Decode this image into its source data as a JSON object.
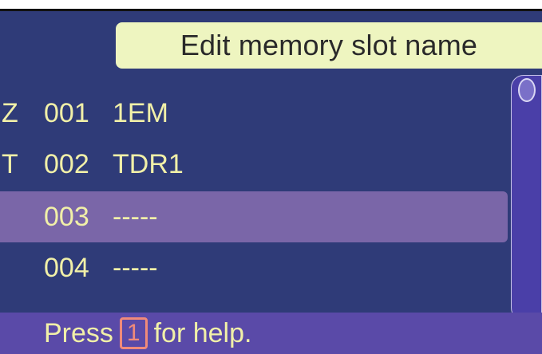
{
  "title": "Edit memory slot name",
  "slots": [
    {
      "flag": "Z",
      "number": "001",
      "name": "1EM",
      "selected": false
    },
    {
      "flag": "T",
      "number": "002",
      "name": "TDR1",
      "selected": false
    },
    {
      "flag": "",
      "number": "003",
      "name": "-----",
      "selected": true
    },
    {
      "flag": "",
      "number": "004",
      "name": "-----",
      "selected": false
    }
  ],
  "footer": {
    "prefix": "Press",
    "key": "1",
    "suffix": "for help."
  },
  "colors": {
    "background": "#2f3b78",
    "title_bg": "#eef5c0",
    "text": "#f1f0a8",
    "selected_row": "#7a66a8",
    "footer_bg": "#5a4aa8",
    "key_highlight": "#f08a7a"
  }
}
